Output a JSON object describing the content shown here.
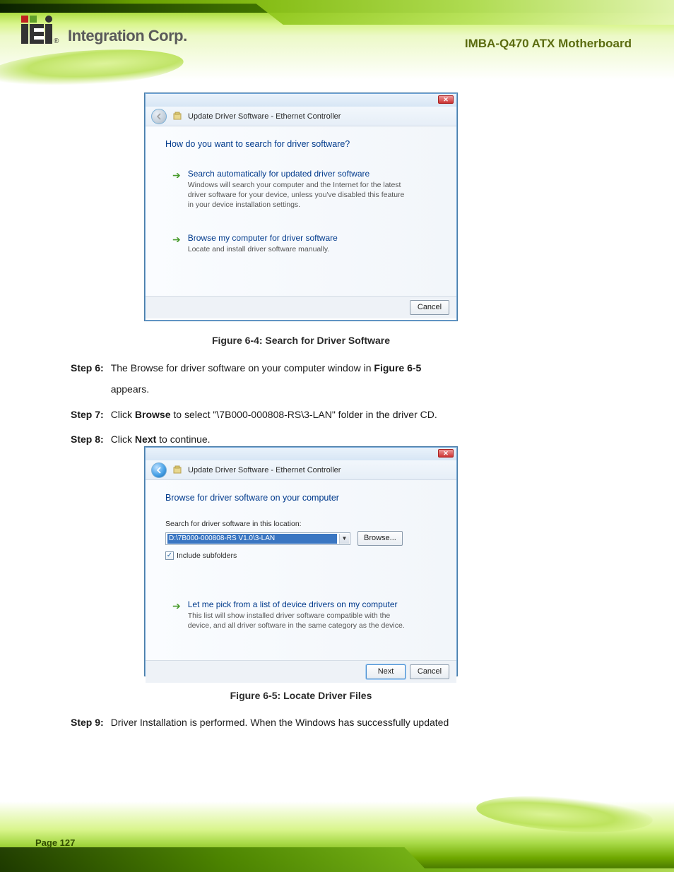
{
  "brand": {
    "logo_text": "Integration Corp.",
    "reg": "®"
  },
  "doc_header_right": "IMBA-Q470 ATX Motherboard",
  "page_number": "Page 127",
  "dialog1": {
    "window_title": "Update Driver Software - Ethernet Controller",
    "prompt": "How do you want to search for driver software?",
    "option1_title": "Search automatically for updated driver software",
    "option1_desc": "Windows will search your computer and the Internet for the latest driver software for your device, unless you've disabled this feature in your device installation settings.",
    "option2_title": "Browse my computer for driver software",
    "option2_desc": "Locate and install driver software manually.",
    "cancel": "Cancel"
  },
  "fig1_label": "Figure 6-4: Search for Driver Software",
  "step6": {
    "num": "Step 6:",
    "text_a": "The Browse for driver software on your computer window in ",
    "bold_ref": "Figure 6-5",
    "text_b": " appears."
  },
  "step7": {
    "num": "Step 7:",
    "text_a": "Click ",
    "bold_browse": "Browse",
    "text_b": " to select \"\\7B000-000808-RS\\3-LAN\" folder in the driver CD."
  },
  "step8": {
    "num": "Step 8:",
    "text_a_1": "Click ",
    "bold_next": "Next",
    "text_a_2": " to continue."
  },
  "dialog2": {
    "window_title": "Update Driver Software - Ethernet Controller",
    "prompt": "Browse for driver software on your computer",
    "field_label": "Search for driver software in this location:",
    "path_value": "D:\\7B000-000808-RS V1.0\\3-LAN",
    "browse_btn": "Browse...",
    "include_subfolders": "Include subfolders",
    "option_title": "Let me pick from a list of device drivers on my computer",
    "option_desc": "This list will show installed driver software compatible with the device, and all driver software in the same category as the device.",
    "next": "Next",
    "cancel": "Cancel"
  },
  "fig2_label": "Figure 6-5: Locate Driver Files",
  "step9": {
    "num": "Step 9:",
    "text": "Driver Installation is performed. When the Windows has successfully updated"
  }
}
